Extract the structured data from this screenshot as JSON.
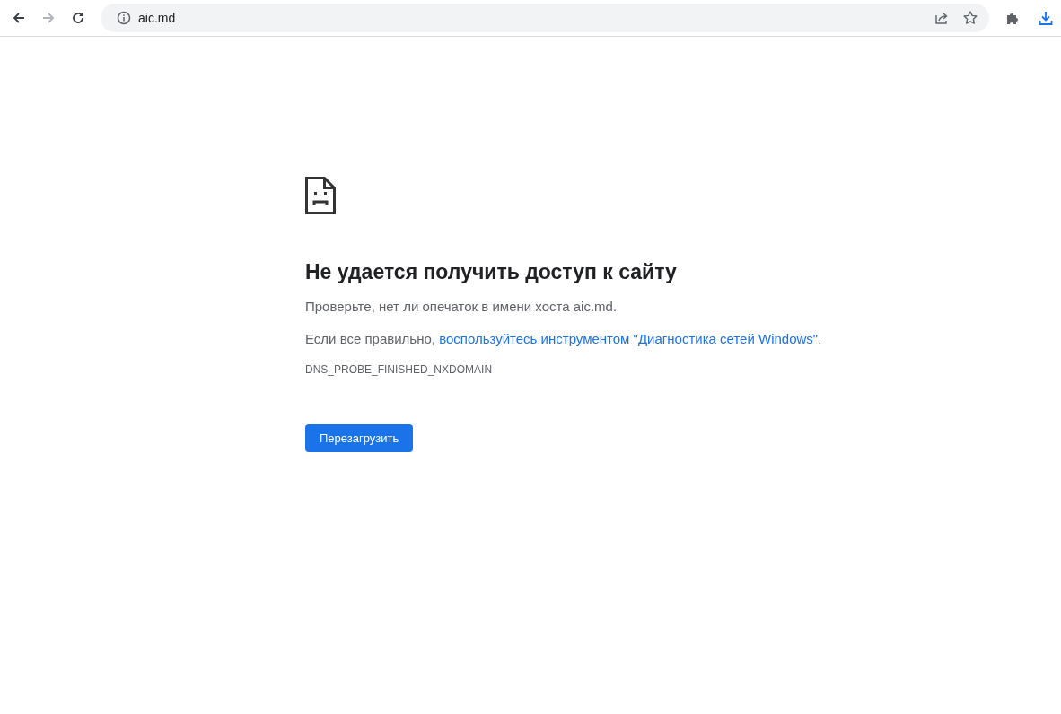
{
  "toolbar": {
    "nav_buttons": [
      {
        "kind": "back",
        "disabled": false
      },
      {
        "kind": "forward",
        "disabled": true
      },
      {
        "kind": "reload",
        "disabled": false
      }
    ],
    "address": "aic.md"
  },
  "error": {
    "title": "Не удается получить доступ к сайту",
    "hint": "Проверьте, нет ли опечаток в имени хоста aic.md.",
    "suggestion": {
      "prefix": "Если все правильно, ",
      "link": "воспользуйтесь инструментом \"Диагностика сетей Windows\"",
      "suffix": "."
    },
    "code": "DNS_PROBE_FINISHED_NXDOMAIN",
    "button": "Перезагрузить"
  }
}
